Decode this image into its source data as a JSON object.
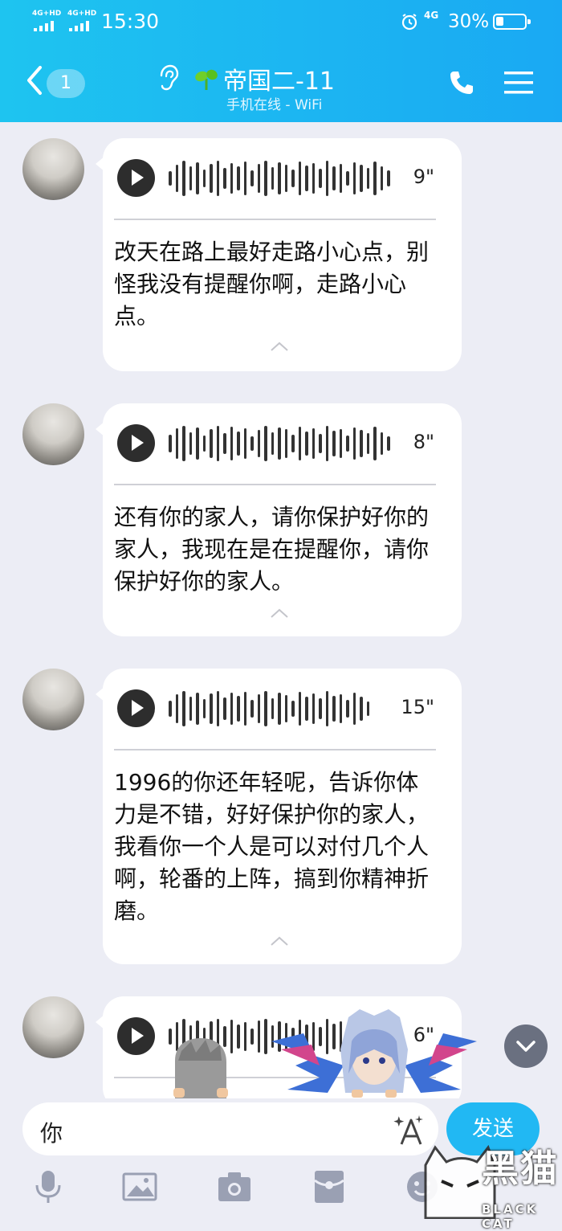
{
  "status_bar": {
    "time": "15:30",
    "signal_1": "4G+HD",
    "signal_2": "4G+HD",
    "network": "4G",
    "battery": "30%"
  },
  "nav": {
    "unread_badge": "1",
    "title": "帝国二-11",
    "subtitle": "手机在线 - WiFi"
  },
  "messages": [
    {
      "duration": "9\"",
      "transcript": "改天在路上最好走路小心点，别怪我没有提醒你啊，走路小心点。"
    },
    {
      "duration": "8\"",
      "transcript": "还有你的家人，请你保护好你的家人，我现在是在提醒你，请你保护好你的家人。"
    },
    {
      "duration": "15\"",
      "transcript": "1996的你还年轻呢，告诉你体力是不错，好好保护你的家人，我看你一个人是可以对付几个人啊，轮番的上阵，搞到你精神折磨。"
    },
    {
      "duration": "6\"",
      "transcript": ""
    }
  ],
  "input": {
    "value": "你",
    "send_label": "发送"
  },
  "watermark": {
    "cn": "黑猫",
    "en": "BLACK CAT"
  },
  "colors": {
    "header_start": "#1ec4f0",
    "header_end": "#1aa9f3",
    "background": "#ecedf5",
    "send_button": "#21b8f3"
  },
  "icons": [
    "back-chevron-icon",
    "ear-icon",
    "sprout-icon",
    "phone-icon",
    "menu-icon",
    "play-icon",
    "font-style-icon",
    "microphone-icon",
    "image-icon",
    "camera-icon",
    "red-packet-icon",
    "emoji-icon",
    "chevron-down-icon"
  ]
}
